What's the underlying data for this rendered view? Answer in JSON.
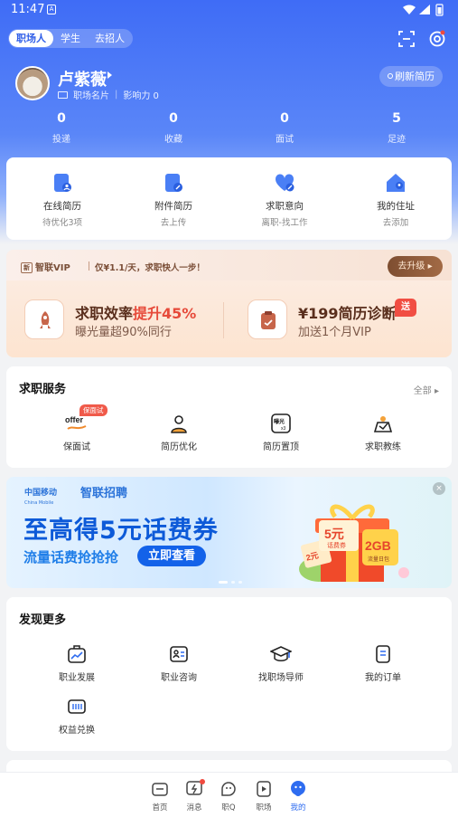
{
  "status_bar": {
    "time": "11:47",
    "sim_label": "A"
  },
  "role_tabs": [
    "职场人",
    "学生",
    "去招人"
  ],
  "profile": {
    "name": "卢紫薇",
    "card_label": "职场名片",
    "influence": "影响力 0",
    "refresh_label": "刷新简历"
  },
  "stats": [
    {
      "value": "0",
      "label": "投递"
    },
    {
      "value": "0",
      "label": "收藏"
    },
    {
      "value": "0",
      "label": "面试"
    },
    {
      "value": "5",
      "label": "足迹"
    }
  ],
  "resume_items": [
    {
      "title": "在线简历",
      "sub": "待优化3项",
      "icon": "resume-icon"
    },
    {
      "title": "附件简历",
      "sub": "去上传",
      "icon": "attachment-icon"
    },
    {
      "title": "求职意向",
      "sub": "离职-找工作",
      "icon": "heart-icon"
    },
    {
      "title": "我的住址",
      "sub": "去添加",
      "icon": "home-location-icon"
    }
  ],
  "vip": {
    "brand": "智联VIP",
    "badge": "新",
    "slogan": "仅¥1.1/天，求职快人一步！",
    "upgrade": "去升级",
    "card1_title_pre": "求职效率",
    "card1_title_hl": "提升45%",
    "card1_sub": "曝光量超90%同行",
    "card2_title": "¥199简历诊断",
    "card2_badge": "送",
    "card2_sub": "加送1个月VIP"
  },
  "job_services": {
    "title": "求职服务",
    "all": "全部",
    "items": [
      {
        "label": "保面试",
        "badge": "保面试",
        "icon": "offer-icon",
        "icon_text": "offer"
      },
      {
        "label": "简历优化",
        "icon": "resume-optimize-icon"
      },
      {
        "label": "简历置顶",
        "icon": "resume-top-icon",
        "icon_text": "曝光",
        "icon_sub": "x3"
      },
      {
        "label": "求职教练",
        "icon": "coach-icon"
      }
    ]
  },
  "banner": {
    "logo1": "中国移动",
    "logo1_sub": "China Mobile",
    "logo2": "智联招聘",
    "title": "至高得5元话费券",
    "subtitle": "流量话费抢抢抢",
    "button": "立即查看",
    "coupon_value": "5元",
    "coupon_label": "话费券",
    "coupon2_value": "2元",
    "data_value": "2GB",
    "data_label": "流量日包",
    "close": "×"
  },
  "discover": {
    "title": "发现更多",
    "items": [
      {
        "label": "职业发展",
        "icon": "career-growth-icon"
      },
      {
        "label": "职业咨询",
        "icon": "consult-icon"
      },
      {
        "label": "找职场导师",
        "icon": "mentor-icon"
      },
      {
        "label": "我的订单",
        "icon": "order-icon"
      },
      {
        "label": "权益兑换",
        "icon": "redeem-icon"
      }
    ]
  },
  "tabbar": [
    {
      "label": "首页",
      "icon": "home-icon"
    },
    {
      "label": "消息",
      "icon": "message-icon"
    },
    {
      "label": "职Q",
      "icon": "zhiq-icon"
    },
    {
      "label": "职场",
      "icon": "workplace-icon"
    },
    {
      "label": "我的",
      "icon": "me-icon"
    }
  ],
  "colors": {
    "primary": "#3f6cf6",
    "tab_active": "#2e6cf0",
    "vip_brown": "#7e4e31",
    "alert_red": "#f14e43"
  }
}
